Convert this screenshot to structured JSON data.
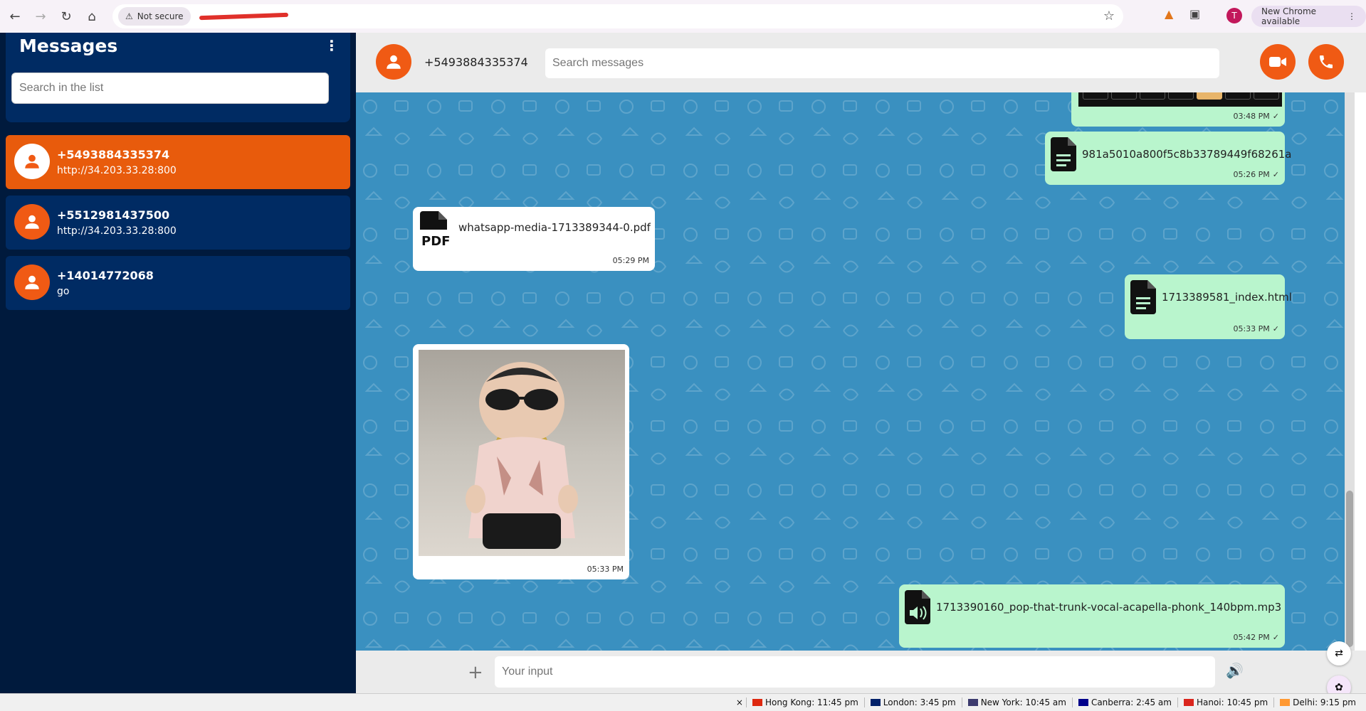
{
  "browser": {
    "security_label": "Not secure",
    "new_chrome_label": "New Chrome available",
    "profile_initial": "T"
  },
  "sidebar": {
    "title": "Messages",
    "search_placeholder": "Search in the list",
    "contacts": [
      {
        "name": "+5493884335374",
        "sub": "http://34.203.33.28:800",
        "active": true
      },
      {
        "name": "+5512981437500",
        "sub": "http://34.203.33.28:800",
        "active": false
      },
      {
        "name": "+14014772068",
        "sub": "go",
        "active": false
      }
    ]
  },
  "chat": {
    "contact_number": "+5493884335374",
    "search_placeholder": "Search messages",
    "messages": [
      {
        "type": "keypad",
        "time": "03:48 PM",
        "dir": "out"
      },
      {
        "type": "file",
        "name": "981a5010a800f5c8b33789449f68261a",
        "time": "05:26 PM",
        "dir": "out",
        "icon": "document-icon"
      },
      {
        "type": "file",
        "name": "whatsapp-media-1713389344-0.pdf",
        "time": "05:29 PM",
        "dir": "in",
        "icon": "pdf-icon"
      },
      {
        "type": "file",
        "name": "1713389581_index.html",
        "time": "05:33 PM",
        "dir": "out",
        "icon": "document-icon"
      },
      {
        "type": "image",
        "time": "05:33 PM",
        "dir": "in"
      },
      {
        "type": "file",
        "name": "1713390160_pop-that-trunk-vocal-acapella-phonk_140bpm.mp3",
        "time": "05:42 PM",
        "dir": "out",
        "icon": "audio-file-icon"
      }
    ]
  },
  "composer": {
    "placeholder": "Your input"
  },
  "clocks": [
    {
      "label": "Hong Kong: 11:45 pm",
      "flag_color": "#de2910"
    },
    {
      "label": "London: 3:45 pm",
      "flag_color": "#012169"
    },
    {
      "label": "New York: 10:45 am",
      "flag_color": "#3c3b6e"
    },
    {
      "label": "Canberra: 2:45 am",
      "flag_color": "#00008b"
    },
    {
      "label": "Hanoi: 10:45 pm",
      "flag_color": "#da251d"
    },
    {
      "label": "Delhi: 9:15 pm",
      "flag_color": "#ff9933"
    }
  ],
  "colors": {
    "accent": "#f05a14",
    "sidebar_bg": "#001a3d",
    "chat_bg": "#3a90c0",
    "outgoing_bubble": "#b9f5cd"
  }
}
